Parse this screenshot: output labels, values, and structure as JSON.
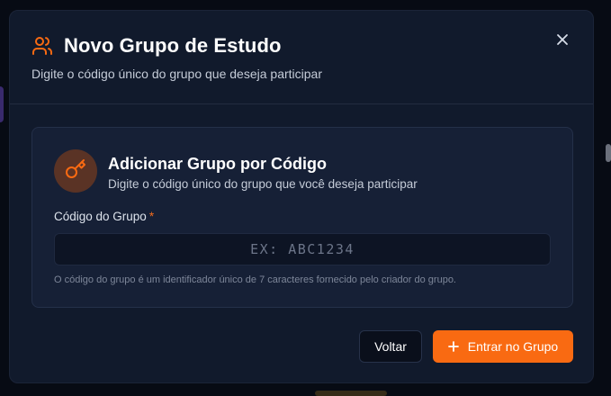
{
  "modal": {
    "title": "Novo Grupo de Estudo",
    "subtitle": "Digite o código único do grupo que deseja participar",
    "title_icon": "users-icon",
    "close_icon": "close-icon"
  },
  "card": {
    "icon": "key-icon",
    "title": "Adicionar Grupo por Código",
    "subtitle": "Digite o código único do grupo que você deseja participar",
    "field_label": "Código do Grupo",
    "required_mark": "*",
    "input_value": "",
    "input_placeholder": "EX: ABC1234",
    "helper_text": "O código do grupo é um identificador único de 7 caracteres fornecido pelo criador do grupo."
  },
  "actions": {
    "back_label": "Voltar",
    "join_label": "Entrar no Grupo",
    "join_icon": "plus-icon"
  },
  "colors": {
    "accent": "#f96a12",
    "modal_bg": "#111a2c",
    "card_bg": "#162036",
    "key_badge_bg": "#5a3325"
  }
}
